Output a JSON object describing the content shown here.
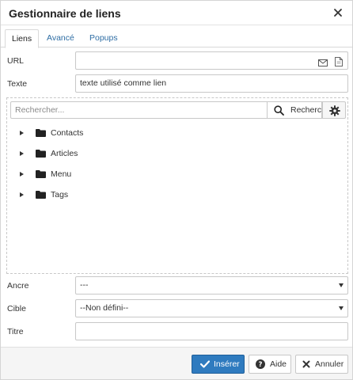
{
  "dialog": {
    "title": "Gestionnaire de liens",
    "close_icon": "close-icon"
  },
  "tabs": [
    {
      "label": "Liens",
      "active": true
    },
    {
      "label": "Avancé",
      "active": false
    },
    {
      "label": "Popups",
      "active": false
    }
  ],
  "url": {
    "label": "URL",
    "value": "",
    "icons": [
      "email-icon",
      "file-icon"
    ]
  },
  "texte": {
    "label": "Texte",
    "value": "texte utilisé comme lien"
  },
  "browser": {
    "search_placeholder": "Rechercher...",
    "search_button": "Rechercher",
    "search_icon": "search-icon",
    "settings_icon": "gear-icon",
    "items": [
      {
        "label": "Contacts",
        "icon": "folder-icon"
      },
      {
        "label": "Articles",
        "icon": "folder-icon"
      },
      {
        "label": "Menu",
        "icon": "folder-icon"
      },
      {
        "label": "Tags",
        "icon": "folder-icon"
      }
    ]
  },
  "ancre": {
    "label": "Ancre",
    "value": "---"
  },
  "cible": {
    "label": "Cible",
    "value": "--Non défini--"
  },
  "titre": {
    "label": "Titre",
    "value": ""
  },
  "footer": {
    "insert_label": "Insérer",
    "help_label": "Aide",
    "cancel_label": "Annuler"
  },
  "colors": {
    "primary": "#2f7bbf",
    "tab_link": "#2e6da4"
  }
}
